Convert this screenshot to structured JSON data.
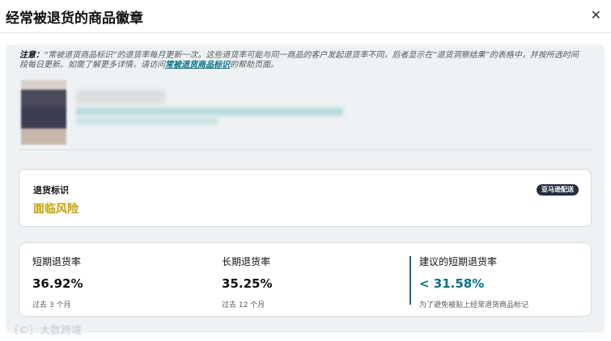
{
  "dialog": {
    "title": "经常被退货的商品徽章",
    "close_symbol": "✕"
  },
  "notice": {
    "prefix": "注意：",
    "text1": "“常被退货商品标识”的退货率每月更新一次。这些退货率可能与同一商品的客户发起退货率不同，后者显示在“退货洞察结果”的表格中，并按所选时间段每日更新。如需了解更多详情，请访问",
    "link": "常被退货商品标识",
    "text2": "的帮助页面。"
  },
  "return_card": {
    "label": "退货标识",
    "value": "面临风险",
    "badge": "亚马逊配送"
  },
  "metrics": [
    {
      "label": "短期退货率",
      "value": "36.92%",
      "sub": "过去 3 个月"
    },
    {
      "label": "长期退货率",
      "value": "35.25%",
      "sub": "过去 12 个月"
    },
    {
      "label": "建议的短期退货率",
      "value": "< 31.58%",
      "sub": "为了避免被贴上经常退货商品标记"
    }
  ],
  "watermark": "〔©〕大数跨境"
}
